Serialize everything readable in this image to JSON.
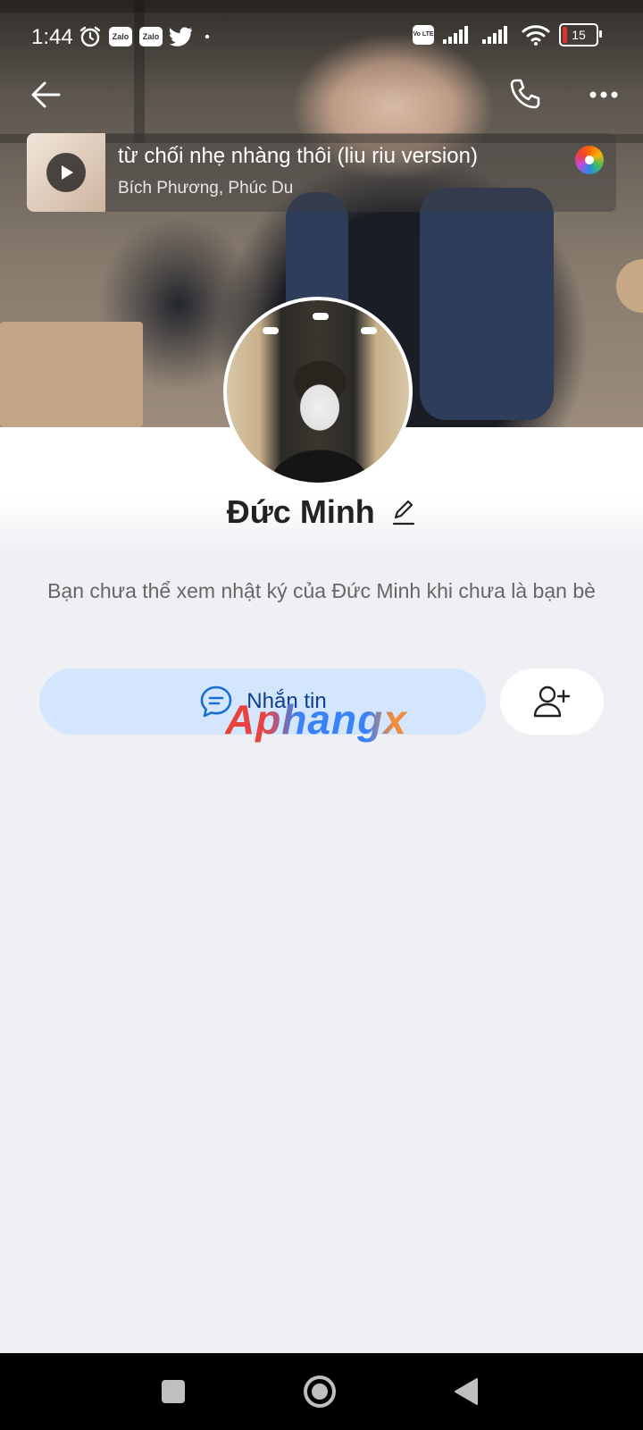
{
  "status_bar": {
    "time": "1:44",
    "left_icons": [
      "alarm-icon",
      "zalo-icon",
      "zalo-icon",
      "twitter-icon",
      "dot-icon"
    ],
    "zalo_text": "Zalo",
    "volte_text": "Vo LTE",
    "battery_level": "15",
    "battery_color": "#e03131"
  },
  "header": {
    "icons": [
      "back-arrow-icon",
      "phone-icon",
      "more-icon"
    ]
  },
  "music": {
    "title": "từ chối nhẹ nhàng thôi (liu riu version)",
    "artist": "Bích Phương, Phúc Du",
    "icons": [
      "play-icon",
      "music-disc-icon"
    ]
  },
  "profile": {
    "name": "Đức Minh",
    "info": "Bạn chưa thể xem nhật ký của Đức Minh khi chưa là bạn bè"
  },
  "actions": {
    "message_label": "Nhắn tin",
    "message_icon": "chat-bubble-icon",
    "add_friend_icon": "add-friend-icon",
    "message_bg": "#d4e6fd",
    "message_color": "#0b3d91"
  },
  "watermark": "Aphangx",
  "nav": {
    "icons": [
      "recents-square-icon",
      "home-circle-icon",
      "back-triangle-icon"
    ]
  }
}
